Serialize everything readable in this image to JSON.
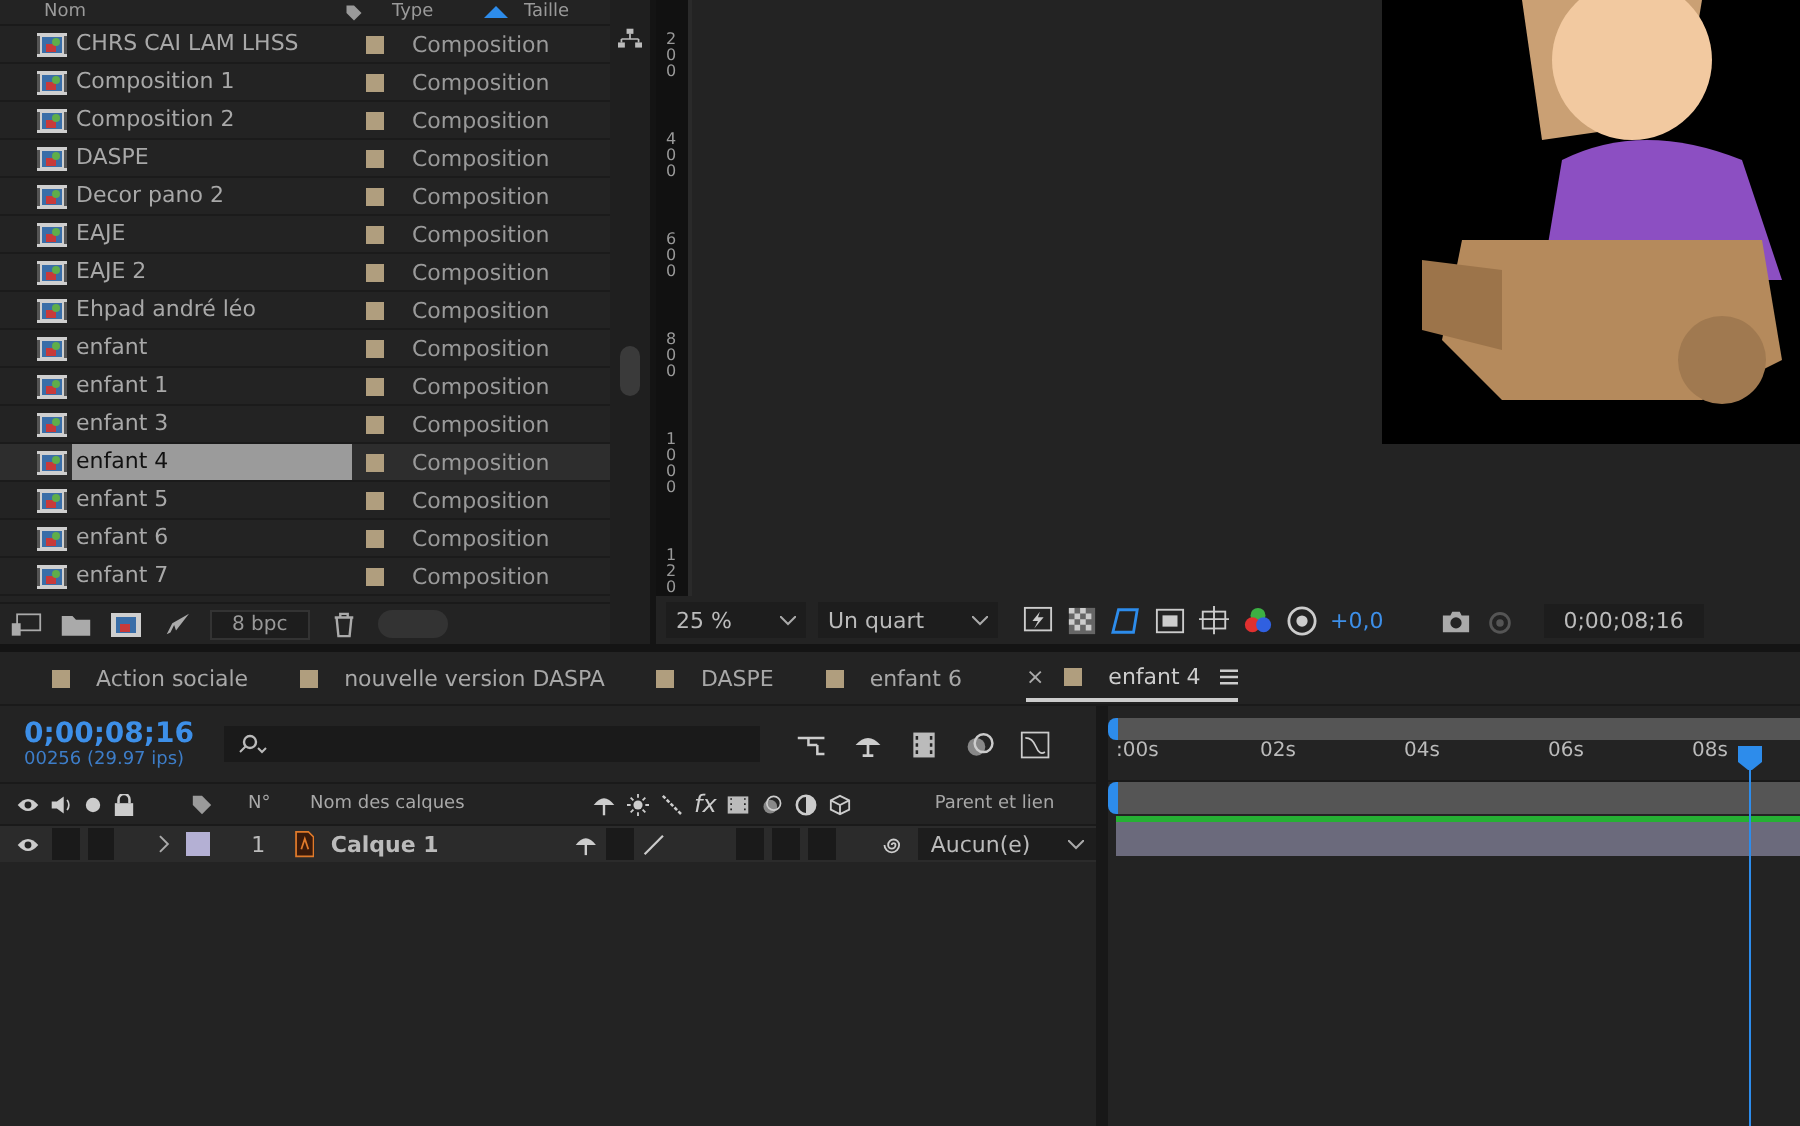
{
  "project": {
    "columns": [
      {
        "label": "Nom"
      },
      {
        "label": "Type"
      },
      {
        "label": "Taille"
      }
    ],
    "items": [
      {
        "name": "CHRS CAI LAM LHSS",
        "type": "Composition",
        "selected": false
      },
      {
        "name": "Composition 1",
        "type": "Composition",
        "selected": false
      },
      {
        "name": "Composition 2",
        "type": "Composition",
        "selected": false
      },
      {
        "name": "DASPE",
        "type": "Composition",
        "selected": false
      },
      {
        "name": "Decor pano 2",
        "type": "Composition",
        "selected": false
      },
      {
        "name": "EAJE",
        "type": "Composition",
        "selected": false
      },
      {
        "name": "EAJE 2",
        "type": "Composition",
        "selected": false
      },
      {
        "name": "Ehpad andré léo",
        "type": "Composition",
        "selected": false
      },
      {
        "name": "enfant",
        "type": "Composition",
        "selected": false
      },
      {
        "name": "enfant 1",
        "type": "Composition",
        "selected": false
      },
      {
        "name": "enfant 3",
        "type": "Composition",
        "selected": false
      },
      {
        "name": "enfant 4",
        "type": "Composition",
        "selected": true
      },
      {
        "name": "enfant 5",
        "type": "Composition",
        "selected": false
      },
      {
        "name": "enfant 6",
        "type": "Composition",
        "selected": false
      },
      {
        "name": "enfant 7",
        "type": "Composition",
        "selected": false
      }
    ],
    "bpc": "8 bpc"
  },
  "viewer": {
    "ruler_labels": [
      "200",
      "400",
      "600",
      "800",
      "1000",
      "120"
    ],
    "zoom": "25 %",
    "resolution": "Un quart",
    "exposure": "+0,0",
    "timecode": "0;00;08;16"
  },
  "timeline": {
    "tabs": [
      {
        "label": "Action sociale",
        "selected": false
      },
      {
        "label": "nouvelle version DASPA",
        "selected": false
      },
      {
        "label": "DASPE",
        "selected": false
      },
      {
        "label": "enfant 6",
        "selected": false
      },
      {
        "label": "enfant 4",
        "selected": true,
        "close": "×"
      }
    ],
    "timecode": "0;00;08;16",
    "frame_info": "00256 (29.97 ips)",
    "ruler": [
      ":00s",
      "02s",
      "04s",
      "06s",
      "08s"
    ],
    "columns": {
      "number": "N°",
      "name": "Nom des calques",
      "effects": "fx",
      "parent": "Parent et lien"
    },
    "layers": [
      {
        "number": "1",
        "name": "Calque 1",
        "visible": true,
        "color": "#b4b0d4",
        "parent": "Aucun(e)"
      }
    ]
  }
}
